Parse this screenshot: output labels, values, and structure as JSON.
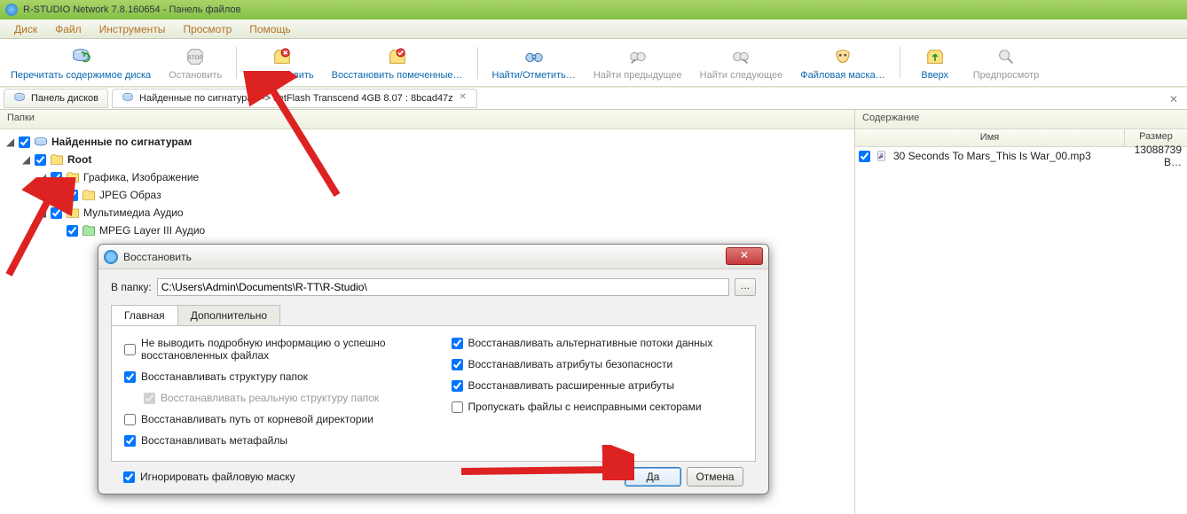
{
  "window": {
    "title": "R-STUDIO Network 7.8.160654 - Панель файлов"
  },
  "menu": {
    "disk": "Диск",
    "file": "Файл",
    "tools": "Инструменты",
    "view": "Просмотр",
    "help": "Помощь"
  },
  "toolbar": {
    "reread": "Перечитать содержимое диска",
    "stop": "Остановить",
    "recover": "Восстановить",
    "recover_marked": "Восстановить помеченные…",
    "find_mark": "Найти/Отметить…",
    "find_prev": "Найти предыдущее",
    "find_next": "Найти следующее",
    "file_mask": "Файловая маска…",
    "up": "Вверх",
    "preview": "Предпросмотр"
  },
  "tabs": {
    "disks": "Панель дисков",
    "found": "Найденные по сигнатурам -> JetFlash Transcend 4GB 8.07 : 8bcad47z"
  },
  "panels": {
    "folders": "Папки",
    "contents": "Содержание",
    "col_name": "Имя",
    "col_size": "Размер"
  },
  "tree": {
    "root": "Найденные по сигнатурам",
    "root2": "Root",
    "graphics": "Графика, Изображение",
    "jpeg": "JPEG Образ",
    "mmaudio": "Мультимедиа Аудио",
    "mpeg": "MPEG Layer III Аудио"
  },
  "files": {
    "f0": {
      "name": "30 Seconds To Mars_This Is War_00.mp3",
      "size": "13088739 В…"
    }
  },
  "dialog": {
    "title": "Восстановить",
    "to_folder_label": "В папку:",
    "to_folder_value": "C:\\Users\\Admin\\Documents\\R-TT\\R-Studio\\",
    "browse": "…",
    "tab_main": "Главная",
    "tab_adv": "Дополнительно",
    "opts": {
      "no_verbose": "Не выводить подробную информацию о успешно восстановленных файлах",
      "restore_folders": "Восстанавливать структуру папок",
      "restore_real_tree": "Восстанавливать реальную структуру папок",
      "restore_from_root": "Восстанавливать путь от корневой директории",
      "restore_meta": "Восстанавливать метафайлы",
      "alt_streams": "Восстанавливать альтернативные потоки данных",
      "sec_attrs": "Восстанавливать атрибуты безопасности",
      "ext_attrs": "Восстанавливать расширенные атрибуты",
      "skip_bad": "Пропускать файлы с неисправными секторами",
      "ignore_mask": "Игнорировать файловую маску"
    },
    "ok": "Да",
    "cancel": "Отмена"
  }
}
